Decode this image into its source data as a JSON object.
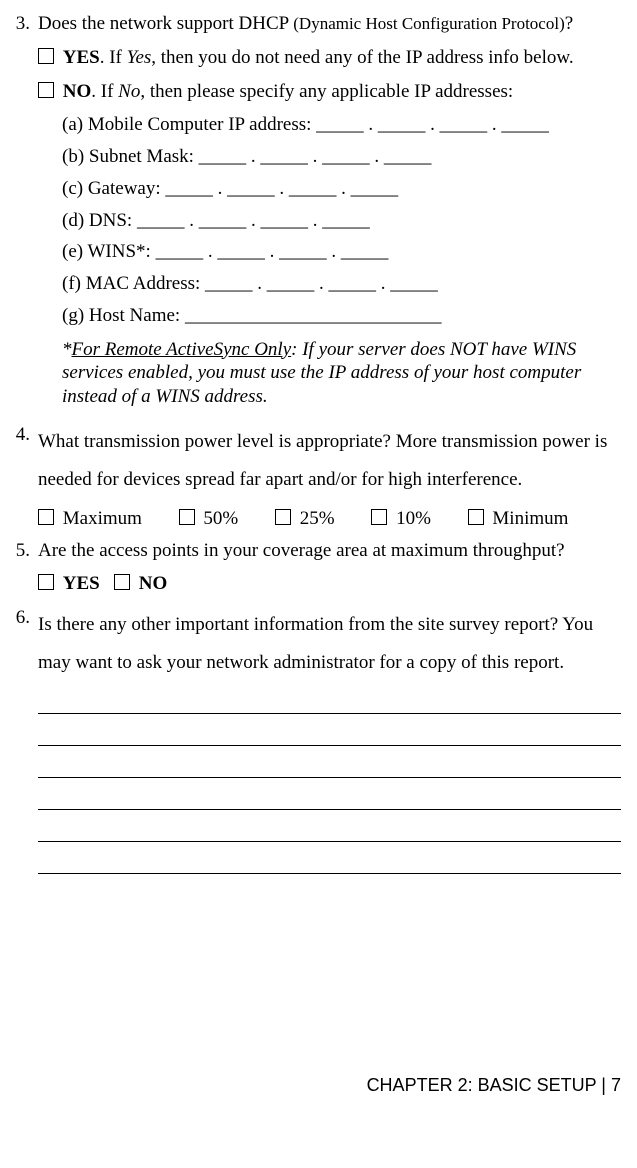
{
  "q3": {
    "marker": "3.",
    "head_a": "Does the network support DHCP ",
    "head_paren": "(Dynamic Host Configuration Protocol)",
    "head_b": "?",
    "yes_label": "YES",
    "yes_rest": ". If ",
    "yes_if": "Yes",
    "yes_tail": ", then you do not need any of the IP address info below.",
    "no_label": "NO",
    "no_rest": ". If ",
    "no_if": "No",
    "no_tail": ", then please specify any applicable IP addresses:",
    "a": "(a) Mobile Computer IP address: _____ . _____ . _____ . _____",
    "b": "(b) Subnet Mask: _____ . _____ . _____ . _____",
    "c": "(c) Gateway: _____ . _____ . _____ . _____",
    "d": "(d) DNS: _____ . _____ . _____ . _____",
    "e": "(e) WINS*: _____ . _____ . _____ . _____",
    "f": "(f) MAC Address: _____ . _____ . _____ . _____",
    "g": "(g) Host Name: ___________________________",
    "note_a": "*",
    "note_u": "For Remote ActiveSync Only",
    "note_b": ": If your server does NOT have WINS services enabled, you must use the IP address of your host computer instead of a WINS address."
  },
  "q4": {
    "marker": "4.",
    "text": "What transmission power level is appropriate? More transmission power is needed for devices spread far apart and/or for high interference.",
    "opts": {
      "max": "Maximum",
      "p50": "50%",
      "p25": "25%",
      "p10": "10%",
      "min": "Minimum"
    }
  },
  "q5": {
    "marker": "5.",
    "text": "Are the access points in your coverage area at maximum throughput?",
    "yes": "YES",
    "no": "NO"
  },
  "q6": {
    "marker": "6.",
    "text": "Is there any other important information from the site survey report? You may want to ask your network administrator for a copy of this report."
  },
  "footer": {
    "chapter": "CHAPTER 2: BASIC SETUP",
    "sep": "  | ",
    "page": "7"
  }
}
